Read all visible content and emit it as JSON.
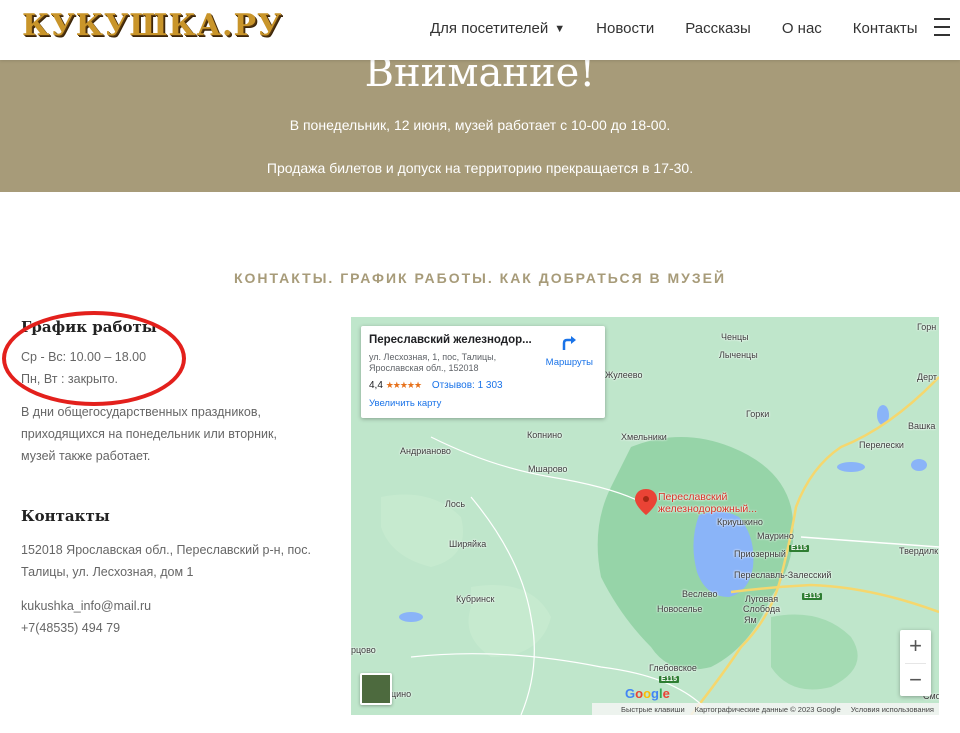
{
  "header": {
    "logo": "КУКУШКА.РУ",
    "nav": [
      "Для посетителей",
      "Новости",
      "Рассказы",
      "О нас",
      "Контакты"
    ]
  },
  "banner": {
    "title": "Внимание!",
    "line1": "В понедельник, 12 июня, музей работает с 10-00 до 18-00.",
    "line2": "Продажа билетов и допуск на территорию прекращается в 17-30."
  },
  "section_title": "КОНТАКТЫ. ГРАФИК РАБОТЫ. КАК ДОБРАТЬСЯ В МУЗЕЙ",
  "schedule": {
    "heading": "График работы",
    "hours": "Ср - Вс: 10.00 – 18.00",
    "closed": "Пн, Вт : закрыто.",
    "holiday": "В дни общегосударственных праздников, приходящихся на понедельник или вторник, музей также работает."
  },
  "contacts": {
    "heading": "Контакты",
    "address": "152018 Ярославская обл., Переславский р-н, пос. Талицы, ул. Лесхозная, дом 1",
    "email": "kukushka_info@mail.ru",
    "phone": "+7(48535) 494 79"
  },
  "map": {
    "card": {
      "title": "Переславский железнодор...",
      "address": "ул. Лесхозная, 1, пос, Талицы, Ярославская обл., 152018",
      "rating": "4,4",
      "stars": "★★★★★",
      "reviews": "Отзывов: 1 303",
      "enlarge": "Увеличить карту",
      "route": "Маршруты"
    },
    "pin_label_1": "Переславский",
    "pin_label_2": "железнодорожный...",
    "places": [
      "Горн",
      "Ченцы",
      "Лыченцы",
      "Жулеево",
      "Дерт",
      "Горки",
      "Вашка",
      "Копнино",
      "Хмельники",
      "Перелески",
      "Андрианово",
      "Мшарово",
      "Лось",
      "Криушкино",
      "Маурино",
      "Ширяйка",
      "Приозерный",
      "Твердилк",
      "Переславль-Залесский",
      "Кубринск",
      "Веслево",
      "Луговая",
      "Слобода",
      "Новоселье",
      "Ям",
      "рцово",
      "Глебовское",
      "цино",
      "Смо"
    ],
    "roads": [
      "E115",
      "E115",
      "E115"
    ],
    "zoom_in": "+",
    "zoom_out": "−",
    "google": "Google",
    "footer": [
      "Быстрые клавиши",
      "Картографические данные © 2023 Google",
      "Условия использования"
    ]
  }
}
